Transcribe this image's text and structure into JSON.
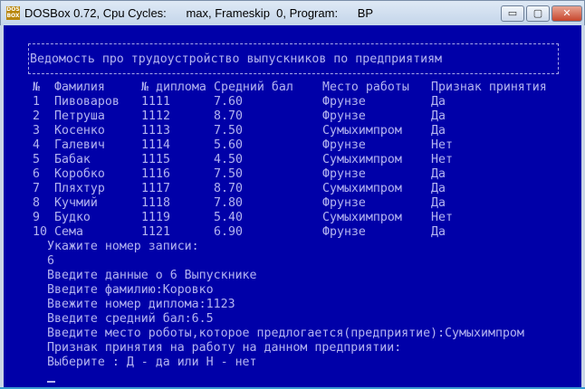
{
  "window": {
    "title": "DOSBox 0.72, Cpu Cycles:      max, Frameskip  0, Program:      BP",
    "icon": "dosbox-icon",
    "buttons": {
      "minimize": "▭",
      "maximize": "▢",
      "close": "✕"
    }
  },
  "heading": "Ведомость про трудоустройство выпускников по предприятиям",
  "table": {
    "headers": [
      "№",
      "Фамилия",
      "№ диплома",
      "Средний бал",
      "Место работы",
      "Признак принятия"
    ],
    "rows": [
      [
        "1",
        "Пивоваров",
        "1111",
        "7.60",
        "Фрунзе",
        "Да"
      ],
      [
        "2",
        "Петруша",
        "1112",
        "8.70",
        "Фрунзе",
        "Да"
      ],
      [
        "3",
        "Косенко",
        "1113",
        "7.50",
        "Сумыхимпром",
        "Да"
      ],
      [
        "4",
        "Галевич",
        "1114",
        "5.60",
        "Фрунзе",
        "Нет"
      ],
      [
        "5",
        "Бабак",
        "1115",
        "4.50",
        "Сумыхимпром",
        "Нет"
      ],
      [
        "6",
        "Коробко",
        "1116",
        "7.50",
        "Фрунзе",
        "Да"
      ],
      [
        "7",
        "Пляхтур",
        "1117",
        "8.70",
        "Сумыхимпром",
        "Да"
      ],
      [
        "8",
        "Кучмий",
        "1118",
        "7.80",
        "Фрунзе",
        "Да"
      ],
      [
        "9",
        "Будко",
        "1119",
        "5.40",
        "Сумыхимпром",
        "Нет"
      ],
      [
        "10",
        "Сема",
        "1121",
        "6.90",
        "Фрунзе",
        "Да"
      ]
    ]
  },
  "console": [
    "Укажите номер записи:",
    "6",
    "Введите данные о 6 Выпускнике",
    "Введите фамилию:Коровко",
    "Ввежите номер диплома:1123",
    "Введите средний бал:6.5",
    "Введите место роботы,которое предлогается(предприятие):Сумыхимпром",
    "Признак принятия на работу на данном предприятии:",
    "Выберите : Д - да или Н - нет"
  ]
}
